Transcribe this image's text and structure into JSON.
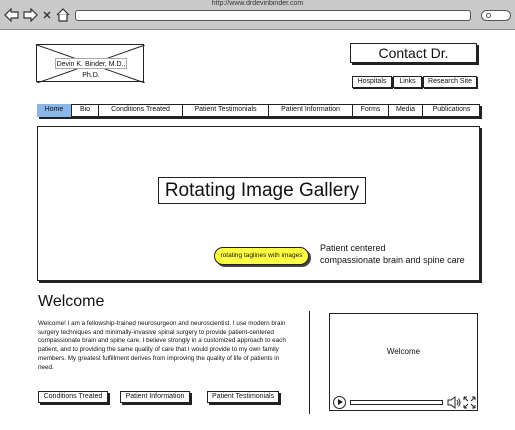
{
  "browser": {
    "url": "http://www.drdevinbinder.com",
    "back_icon": "back-arrow-icon",
    "forward_icon": "forward-arrow-icon",
    "close_icon": "close-icon",
    "home_icon": "home-icon"
  },
  "header": {
    "logo_text": "Devin K. Binder, M.D., Ph.D.",
    "contact_label": "Contact Dr.",
    "utility_links": [
      "Hospitals",
      "Links",
      "Research Site"
    ]
  },
  "nav": {
    "items": [
      "Home",
      "Bio",
      "Conditions Treated",
      "Patient Testimonials",
      "Patient Information",
      "Forms",
      "Media",
      "Publications"
    ],
    "active": "Home"
  },
  "hero": {
    "gallery_label": "Rotating Image Gallery",
    "tagline_button": "rotating taglines with images",
    "tagline_line1": "Patient centered",
    "tagline_line2": "compassionate brain and spine care"
  },
  "welcome": {
    "heading": "Welcome",
    "body": "Welcome!  I am a fellowship-trained neurosurgeon and neuroscientist.  I use modern brain surgery techniques and minimally-invasive spinal surgery to provide patient-centered compassionate brain and spine care.  I believe strongly in a customized approach to each patient, and to providing the same quality of care that I would provide to my own family members.  My greatest fulfillment derives from improving the quality of life of patients in need.",
    "buttons": [
      "Conditions Treated",
      "Patient Information",
      "Patient Testimonials"
    ]
  },
  "video": {
    "title": "Welcome",
    "play_icon": "play-icon",
    "volume_icon": "volume-icon",
    "fullscreen_icon": "fullscreen-icon"
  },
  "colors": {
    "active_tab": "#8ab6e8",
    "tagline_highlight": "#ffff44"
  }
}
